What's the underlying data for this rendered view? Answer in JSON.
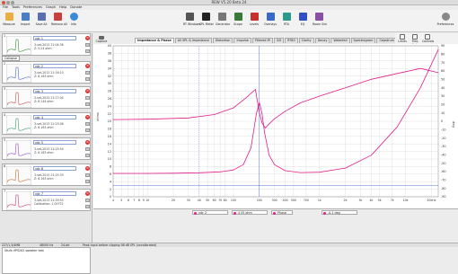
{
  "window": {
    "title": "REW V5.20 Beta 24"
  },
  "menu": [
    "File",
    "Tools",
    "Preferences",
    "Graph",
    "Help",
    "Donate"
  ],
  "toolbar": {
    "left": [
      {
        "label": "Measure",
        "icon": "microphone-icon",
        "color": "#e8b040"
      },
      {
        "label": "Import",
        "icon": "folder-open-icon",
        "color": "#4a7fc8"
      },
      {
        "label": "Save All",
        "icon": "save-icon",
        "color": "#5a6fb0"
      },
      {
        "label": "Remove All",
        "icon": "remove-all-icon",
        "color": "#c84040"
      },
      {
        "label": "Info",
        "icon": "info-icon",
        "color": "#3a8ad8"
      }
    ],
    "right": [
      {
        "label": "RT Windows",
        "icon": "rt-windows-icon",
        "color": "#555555"
      },
      {
        "label": "SPL Meter",
        "icon": "spl-meter-icon",
        "color": "#222222"
      },
      {
        "label": "Generator",
        "icon": "generator-icon",
        "color": "#777777"
      },
      {
        "label": "Scope",
        "icon": "scope-icon",
        "color": "#3a7a3a"
      },
      {
        "label": "Levels",
        "icon": "levels-icon",
        "color": "#c83030"
      },
      {
        "label": "Overlays",
        "icon": "overlays-icon",
        "color": "#3a6ac8"
      },
      {
        "label": "RTA",
        "icon": "rta-icon",
        "color": "#2a9a8a"
      },
      {
        "label": "EQ",
        "icon": "eq-icon",
        "color": "#3050c8"
      },
      {
        "label": "Room Sim",
        "icon": "room-sim-icon",
        "color": "#8a50a8"
      }
    ],
    "preferences": {
      "label": "Preferences",
      "icon": "preferences-icon"
    }
  },
  "sidebar": {
    "collapse_label": "Collapse",
    "measurements": [
      {
        "number": "1",
        "name": "vdc 1",
        "date": "3-set-2013 21:04:36",
        "info": "Z: 5.24 ohm",
        "thumb_color": "#3a8a3a"
      },
      {
        "number": "2",
        "name": "vdc 2",
        "date": "3-set-2013 21:16:10",
        "info": "Z: 6.163 ohm",
        "thumb_color": "#4a6ac8"
      },
      {
        "number": "3",
        "name": "vdc 3",
        "date": "3-set-2013 21:17:04",
        "info": "Z: 6.144 ohm",
        "thumb_color": "#c84a4a"
      },
      {
        "number": "4",
        "name": "vdc 4",
        "date": "3-set-2013 21:23:06",
        "info": "Z: 6.163 ohm",
        "thumb_color": "#3a9a6a"
      },
      {
        "number": "5",
        "name": "vdc 5",
        "date": "3-set-2013 21:23:54",
        "info": "Z: 6.163 ohm",
        "thumb_color": "#9a4ac8"
      },
      {
        "number": "6",
        "name": "vdc 6",
        "date": "3-set-2013 21:25:33",
        "info": "Z: 6.163 ohm",
        "thumb_color": "#c86a2a"
      },
      {
        "number": "7",
        "name": "vdc 7",
        "date": "3-set-2013 21:29:53",
        "info": "Calibration: 1.00752",
        "thumb_color": "#c83a6a"
      }
    ],
    "notes": "Stufa VPS202 speaker test"
  },
  "tabs": [
    "Impedance & Phase",
    "All SPL & Impedance",
    "Distortion",
    "Impulse",
    "Filtered IR",
    "GD",
    "RT60",
    "Clarity",
    "Decay",
    "Waterfall",
    "Spectrogram",
    "Cepstrum"
  ],
  "right_tools": [
    {
      "label": "Limits",
      "icon": "limits-icon"
    },
    {
      "label": "Freq Axis",
      "icon": "freq-axis-icon"
    },
    {
      "label": "Controls",
      "icon": "controls-icon"
    }
  ],
  "capture_label": "Capture",
  "axis": {
    "y_label": "ohms",
    "y_ticks": [
      "40",
      "38",
      "36",
      "34",
      "32",
      "30",
      "28",
      "26",
      "24",
      "22",
      "20",
      "18",
      "16",
      "14",
      "12",
      "10",
      "8",
      "6",
      "4",
      "2",
      "0"
    ],
    "phase_label": "deg",
    "phase_ticks": [
      "90",
      "80",
      "70",
      "60",
      "50",
      "40",
      "30",
      "20",
      "10",
      "0",
      "-10",
      "-20",
      "-30",
      "-40",
      "-50",
      "-60",
      "-70",
      "-80",
      "-90"
    ],
    "x_ticks": [
      "4",
      "5",
      "6",
      "7",
      "8",
      "9",
      "10",
      "20",
      "30",
      "40",
      "50",
      "60",
      "70",
      "80",
      "100",
      "200",
      "300",
      "400",
      "500",
      "700",
      "1k",
      "2k",
      "3k",
      "4k",
      "5k",
      "7k",
      "10k",
      "20kHz"
    ],
    "x_unit": "Hz"
  },
  "chart_data": {
    "type": "line",
    "x_scale": "log",
    "xlim": [
      4,
      24000
    ],
    "ylim": [
      0,
      40
    ],
    "y2lim": [
      -90,
      90
    ],
    "grid": true,
    "series": [
      {
        "name": "vdc 2",
        "axis": "ohms",
        "color": "#e0208a",
        "x": [
          4,
          10,
          20,
          40,
          70,
          100,
          130,
          160,
          185,
          200,
          215,
          230,
          260,
          300,
          400,
          600,
          1000,
          2000,
          4000,
          8000,
          15000,
          24000
        ],
        "y": [
          6.2,
          6.2,
          6.25,
          6.35,
          6.6,
          7.1,
          8.5,
          13,
          22,
          25,
          22,
          17,
          11,
          8.5,
          6.9,
          6.4,
          6.5,
          7.6,
          11,
          18.5,
          29,
          39
        ]
      },
      {
        "name": "Phase",
        "axis": "deg",
        "color": "#e0208a",
        "x": [
          4,
          10,
          30,
          60,
          100,
          140,
          180,
          200,
          215,
          235,
          260,
          300,
          400,
          600,
          1000,
          2000,
          4000,
          8000,
          15000,
          24000
        ],
        "y": [
          2,
          2.5,
          4,
          8,
          16,
          28,
          38,
          10,
          -2,
          -8,
          -3,
          3,
          12,
          22,
          30,
          40,
          50,
          57,
          63,
          58
        ]
      }
    ]
  },
  "markers": {
    "cursor_freq": "200",
    "value_ohms": "3.00"
  },
  "controls": [
    {
      "label": "vdc 2",
      "value": "",
      "color": "#e0208a"
    },
    {
      "label": "",
      "value": "4.55 ohm",
      "color": "#e0208a"
    },
    {
      "label": "Phase",
      "value": "-0.1 deg",
      "color": "#e0208a"
    }
  ],
  "status": {
    "memory": "227/1,3/4MB",
    "rate": "48000 Hz",
    "bits": "24-bit",
    "message": "Peak input before clipping 98 dB SPL (uncalibrated)"
  }
}
